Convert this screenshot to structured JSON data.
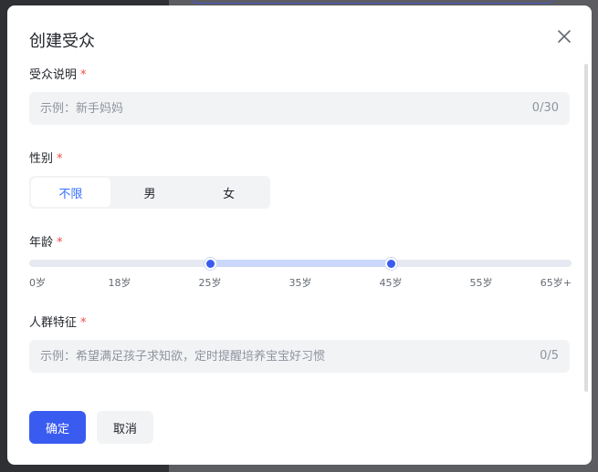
{
  "modal": {
    "title": "创建受众"
  },
  "audience_desc": {
    "label": "受众说明",
    "required_mark": "*",
    "placeholder": "示例：新手妈妈",
    "counter": "0/30"
  },
  "gender": {
    "label": "性别",
    "required_mark": "*",
    "options": [
      "不限",
      "男",
      "女"
    ],
    "selected": "不限"
  },
  "age": {
    "label": "年龄",
    "required_mark": "*",
    "ticks": [
      "0岁",
      "18岁",
      "25岁",
      "35岁",
      "45岁",
      "55岁",
      "65岁+"
    ],
    "range": [
      "25岁",
      "45岁"
    ]
  },
  "traits": {
    "label": "人群特征",
    "required_mark": "*",
    "placeholder": "示例：希望满足孩子求知欲，定时提醒培养宝宝好习惯",
    "counter": "0/5"
  },
  "footer": {
    "confirm_label": "确定",
    "cancel_label": "取消"
  },
  "colors": {
    "primary": "#3a5bf0",
    "required": "#f54a45",
    "selected_text": "#3370ff",
    "range_fill": "#c9d8fb"
  },
  "icons": {
    "close": "close-icon"
  }
}
